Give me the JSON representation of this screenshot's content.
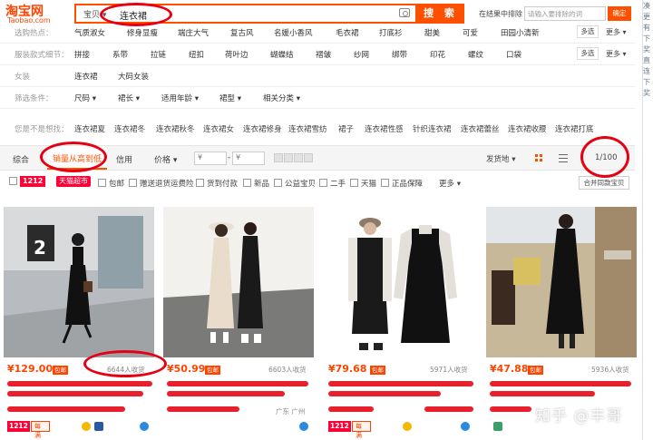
{
  "header": {
    "logo_cn": "淘宝网",
    "logo_en": "Taobao.com",
    "search_category": "宝贝",
    "search_value": "连衣裙",
    "search_button": "搜 索",
    "exclude_label": "在结果中排除",
    "exclude_placeholder": "请输入要排除的词",
    "confirm": "确定"
  },
  "filters": [
    {
      "label": "选购热点：",
      "options": [
        "气质淑女",
        "修身显瘦",
        "端庄大气",
        "复古风",
        "名媛小香风",
        "毛衣裙",
        "打底衫",
        "甜美",
        "可爱",
        "田园小清新"
      ],
      "more": "多选",
      "more2": "更多 ▾"
    },
    {
      "label": "服装款式细节：",
      "options": [
        "拼接",
        "系带",
        "拉链",
        "纽扣",
        "荷叶边",
        "蝴蝶结",
        "褶皱",
        "纱网",
        "绑带",
        "印花",
        "螺纹",
        "口袋"
      ],
      "more": "多选",
      "more2": "更多 ▾"
    },
    {
      "label": "女装",
      "options": [
        "连衣裙",
        "大码女装"
      ]
    },
    {
      "label": "筛选条件：",
      "options": [
        "尺码 ▾",
        "裙长 ▾",
        "适用年龄 ▾",
        "裙型 ▾",
        "相关分类 ▾"
      ]
    }
  ],
  "suggest": {
    "label": "您是不是想找：",
    "items": [
      "连衣裙夏",
      "连衣裙冬",
      "连衣裙秋冬",
      "连衣裙女",
      "连衣裙修身",
      "连衣裙雪纺",
      "裙子",
      "连衣裙性感",
      "针织连衣裙",
      "连衣裙蕾丝",
      "连衣裙收腰",
      "连衣裙打底"
    ]
  },
  "sortbar": {
    "default": "综合",
    "sales": "销量从高到低",
    "credit": "信用",
    "price": "价格 ▾",
    "price_from": "¥",
    "price_to": "¥",
    "ship": "发货地 ▾",
    "page": "1/100",
    "prev": "‹"
  },
  "options": {
    "tag1212": "1212",
    "tmall": "天猫超市",
    "checks": [
      "包邮",
      "赠送退货运费险",
      "货到付款",
      "新品",
      "公益宝贝",
      "二手",
      "天猫",
      "正品保障"
    ],
    "more": "更多 ▾",
    "merge": "合并同款宝贝"
  },
  "products": [
    {
      "price": "¥129.00",
      "bao": "包邮",
      "sales": "6644人收货",
      "location": "",
      "coupon": "每满200减20"
    },
    {
      "price": "¥50.99",
      "bao": "包邮",
      "sales": "6603人收货",
      "location": "广东 广州",
      "coupon": ""
    },
    {
      "price": "¥79.68",
      "bao": "包邮",
      "sales": "5971人收货",
      "location": "",
      "coupon": "每满200减20"
    },
    {
      "price": "¥47.88",
      "bao": "包邮",
      "sales": "5936人收货",
      "location": "",
      "coupon": ""
    }
  ],
  "right_strip": [
    "凑",
    "更",
    "有",
    "下",
    "奖",
    "直",
    "连",
    "下",
    "奖"
  ],
  "watermark": "知乎 @丰哥",
  "colors": {
    "brand": "#ff5000",
    "price": "#ff4400",
    "annotation": "#e60012"
  }
}
